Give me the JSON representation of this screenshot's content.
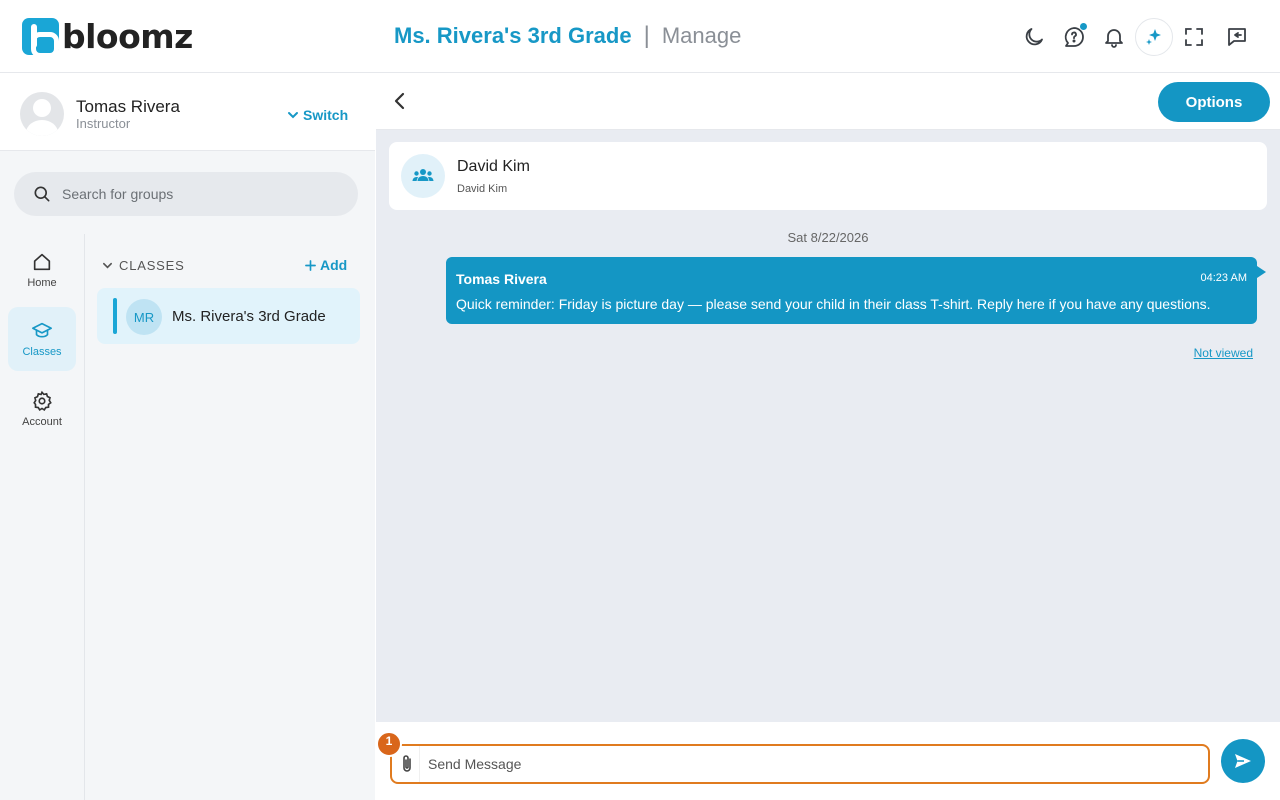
{
  "app": {
    "logo_text": "bloomz"
  },
  "header": {
    "class_name": "Ms. Rivera's 3rd Grade",
    "separator": "|",
    "mode": "Manage",
    "icons": [
      "moon-icon",
      "help-chat-icon",
      "bell-icon",
      "sparkle-icon",
      "fullscreen-icon",
      "collapse-panel-icon"
    ],
    "accent": "#1798c6"
  },
  "profile": {
    "name": "Tomas Rivera",
    "role": "Instructor",
    "switch_label": "Switch"
  },
  "search": {
    "placeholder": "Search for groups"
  },
  "nav": {
    "items": [
      {
        "label": "Home",
        "icon": "home-icon",
        "active": false
      },
      {
        "label": "Classes",
        "icon": "graduation-cap-icon",
        "active": true
      },
      {
        "label": "Account",
        "icon": "gear-icon",
        "active": false
      }
    ]
  },
  "classes": {
    "heading": "CLASSES",
    "add_label": "Add",
    "items": [
      {
        "initials": "MR",
        "name": "Ms. Rivera's 3rd Grade"
      }
    ]
  },
  "chat": {
    "options_label": "Options",
    "recipient": {
      "name": "David Kim",
      "subtitle": "David Kim"
    },
    "date": "Sat 8/22/2026",
    "messages": [
      {
        "sender": "Tomas Rivera",
        "time": "04:23 AM",
        "text": "Quick reminder: Friday is picture day — please send your child in their class T-shirt. Reply here if you have any questions.",
        "status": "Not viewed"
      }
    ],
    "composer": {
      "placeholder": "Send Message",
      "step_number": "1"
    }
  }
}
